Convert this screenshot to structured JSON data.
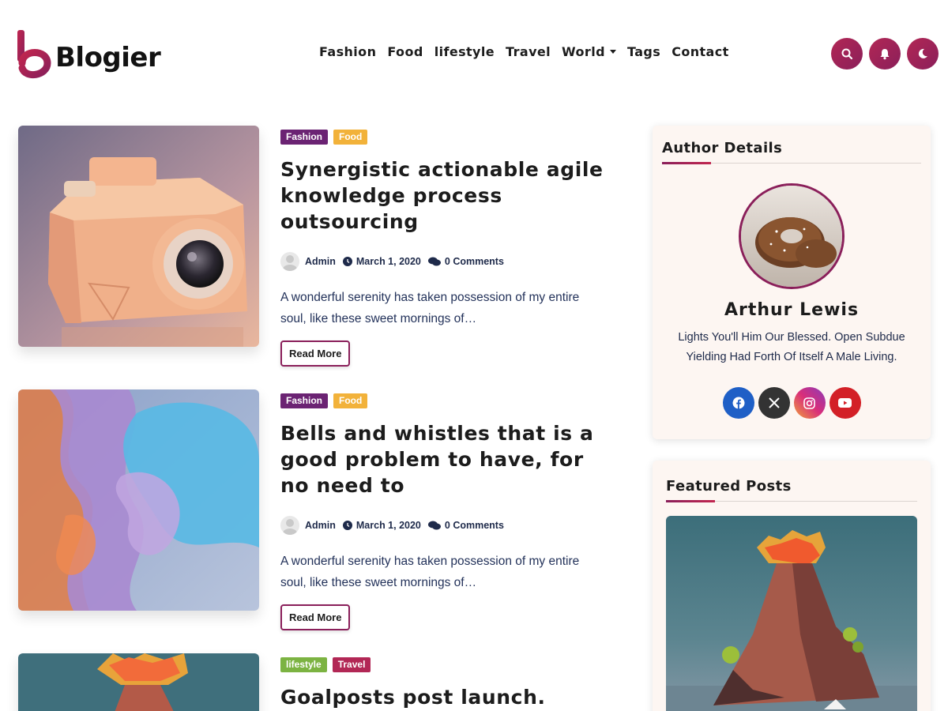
{
  "header": {
    "logo_text": "Blogier",
    "nav": [
      {
        "label": "Fashion"
      },
      {
        "label": "Food"
      },
      {
        "label": "lifestyle"
      },
      {
        "label": "Travel"
      },
      {
        "label": "World",
        "has_dropdown": true
      },
      {
        "label": "Tags"
      },
      {
        "label": "Contact"
      }
    ],
    "buttons": [
      "search-icon",
      "bell-icon",
      "moon-icon"
    ]
  },
  "posts": [
    {
      "tags": [
        {
          "label": "Fashion",
          "color": "#6b2373"
        },
        {
          "label": "Food",
          "color": "#f2b23a"
        }
      ],
      "title": "Synergistic actionable agile knowledge process outsourcing",
      "author": "Admin",
      "date": "March 1, 2020",
      "comments": "0 Comments",
      "excerpt": "A wonderful serenity has taken possession of my entire soul, like these sweet mornings of…",
      "read_more": "Read More"
    },
    {
      "tags": [
        {
          "label": "Fashion",
          "color": "#6b2373"
        },
        {
          "label": "Food",
          "color": "#f2b23a"
        }
      ],
      "title": "Bells and whistles that is a good problem to have, for no need to",
      "author": "Admin",
      "date": "March 1, 2020",
      "comments": "0 Comments",
      "excerpt": "A wonderful serenity has taken possession of my entire soul, like these sweet mornings of…",
      "read_more": "Read More"
    },
    {
      "tags": [
        {
          "label": "lifestyle",
          "color": "#7cb342"
        },
        {
          "label": "Travel",
          "color": "#b22755"
        }
      ],
      "title": "Goalposts post launch. Regroup"
    }
  ],
  "sidebar": {
    "author_widget": {
      "title": "Author Details",
      "name": "Arthur Lewis",
      "bio": "Lights You'll Him Our Blessed. Open Subdue Yielding Had Forth Of Itself A Male Living.",
      "socials": [
        {
          "name": "facebook-icon",
          "color": "#1f5fc6"
        },
        {
          "name": "x-icon",
          "color": "#333333"
        },
        {
          "name": "instagram-icon",
          "color": "#c53a8c"
        },
        {
          "name": "youtube-icon",
          "color": "#d32027"
        }
      ]
    },
    "featured_widget": {
      "title": "Featured Posts"
    }
  },
  "colors": {
    "accent": "#8a1f5a",
    "accent_alt": "#c1264f"
  }
}
